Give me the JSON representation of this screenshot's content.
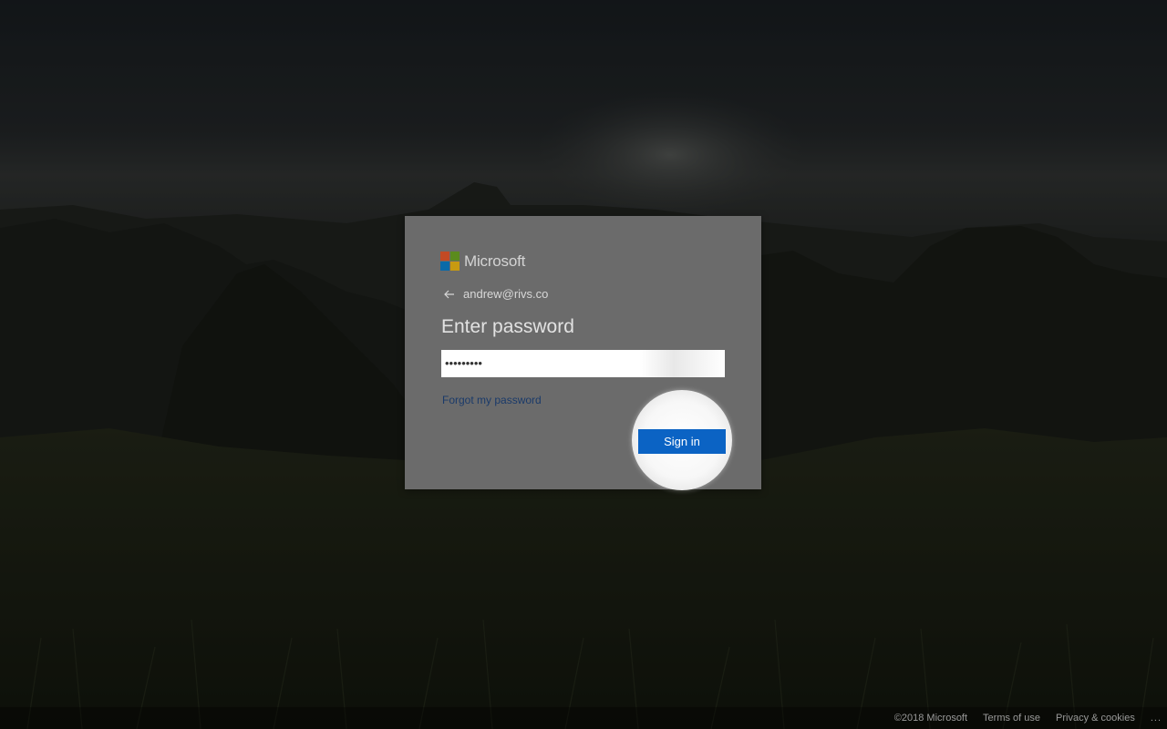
{
  "brand": {
    "name": "Microsoft",
    "colors": {
      "red": "#c24a24",
      "green": "#5b8b1d",
      "blue": "#0a6aa8",
      "yellow": "#c79a11"
    }
  },
  "identity": {
    "back_icon": "arrow-left-icon",
    "email": "andrew@rivs.co"
  },
  "title": "Enter password",
  "password": {
    "value": "•••••••••"
  },
  "forgot_link": "Forgot my password",
  "signin_button": {
    "label": "Sign in",
    "color": "#0b63c4"
  },
  "footer": {
    "copyright": "©2018 Microsoft",
    "terms": "Terms of use",
    "privacy": "Privacy & cookies",
    "more": "..."
  }
}
